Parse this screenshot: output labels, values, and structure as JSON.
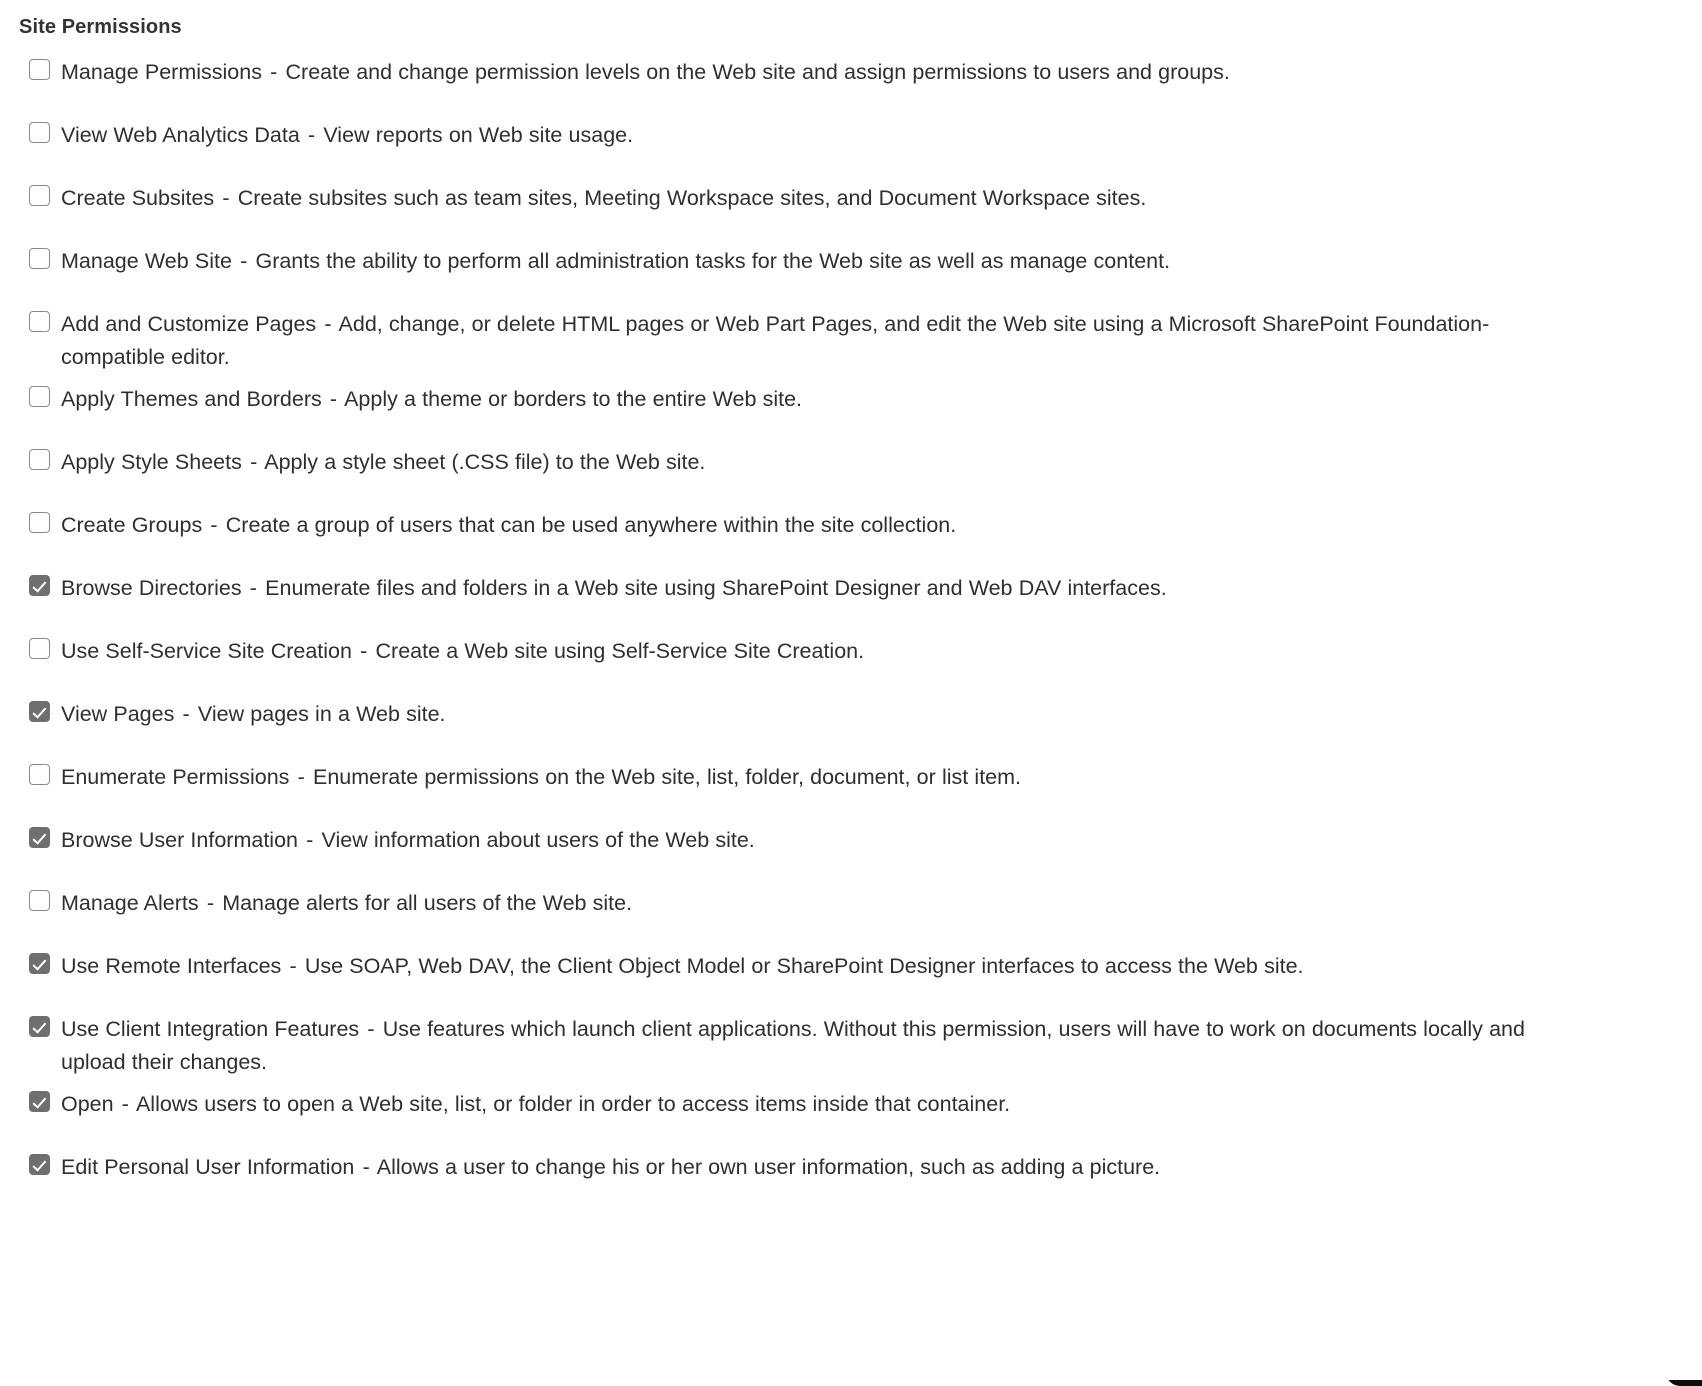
{
  "section": {
    "title": "Site Permissions"
  },
  "separator": "-",
  "permissions": [
    {
      "name": "Manage Permissions",
      "description": "Create and change permission levels on the Web site and assign permissions to users and groups.",
      "checked": false
    },
    {
      "name": "View Web Analytics Data",
      "description": "View reports on Web site usage.",
      "checked": false
    },
    {
      "name": "Create Subsites",
      "description": "Create subsites such as team sites, Meeting Workspace sites, and Document Workspace sites.",
      "checked": false
    },
    {
      "name": "Manage Web Site",
      "description": "Grants the ability to perform all administration tasks for the Web site as well as manage content.",
      "checked": false
    },
    {
      "name": "Add and Customize Pages",
      "description": "Add, change, or delete HTML pages or Web Part Pages, and edit the Web site using a Microsoft SharePoint Foundation-compatible editor.",
      "checked": false
    },
    {
      "name": "Apply Themes and Borders",
      "description": "Apply a theme or borders to the entire Web site.",
      "checked": false
    },
    {
      "name": "Apply Style Sheets",
      "description": "Apply a style sheet (.CSS file) to the Web site.",
      "checked": false
    },
    {
      "name": "Create Groups",
      "description": "Create a group of users that can be used anywhere within the site collection.",
      "checked": false
    },
    {
      "name": "Browse Directories",
      "description": "Enumerate files and folders in a Web site using SharePoint Designer and Web DAV interfaces.",
      "checked": true
    },
    {
      "name": "Use Self-Service Site Creation",
      "description": "Create a Web site using Self-Service Site Creation.",
      "checked": false
    },
    {
      "name": "View Pages",
      "description": "View pages in a Web site.",
      "checked": true
    },
    {
      "name": "Enumerate Permissions",
      "description": "Enumerate permissions on the Web site, list, folder, document, or list item.",
      "checked": false
    },
    {
      "name": "Browse User Information",
      "description": "View information about users of the Web site.",
      "checked": true
    },
    {
      "name": "Manage Alerts",
      "description": "Manage alerts for all users of the Web site.",
      "checked": false
    },
    {
      "name": "Use Remote Interfaces",
      "description": "Use SOAP, Web DAV, the Client Object Model or SharePoint Designer interfaces to access the Web site.",
      "checked": true
    },
    {
      "name": "Use Client Integration Features",
      "description": "Use features which launch client applications. Without this permission, users will have to work on documents locally and upload their changes.",
      "checked": true
    },
    {
      "name": "Open",
      "description": "Allows users to open a Web site, list, or folder in order to access items inside that container.",
      "checked": true
    },
    {
      "name": "Edit Personal User Information",
      "description": "Allows a user to change his or her own user information, such as adding a picture.",
      "checked": true
    }
  ]
}
